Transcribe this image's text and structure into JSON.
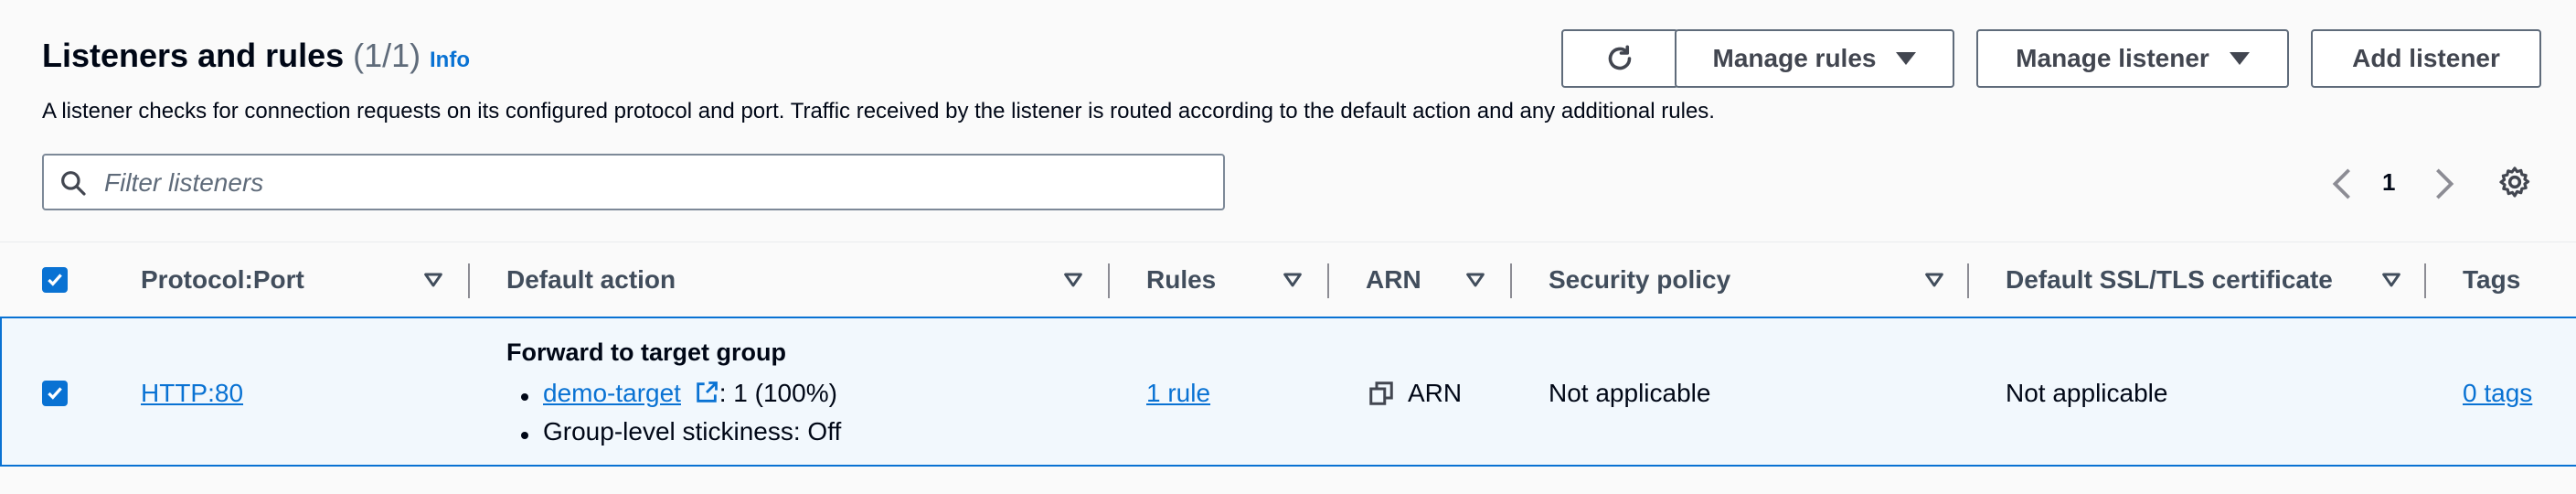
{
  "header": {
    "title": "Listeners and rules",
    "count": "(1/1)",
    "info_label": "Info",
    "description": "A listener checks for connection requests on its configured protocol and port. Traffic received by the listener is routed according to the default action and any additional rules."
  },
  "toolbar": {
    "refresh_icon": "refresh-icon",
    "manage_rules_label": "Manage rules",
    "manage_listener_label": "Manage listener",
    "add_listener_label": "Add listener"
  },
  "search": {
    "placeholder": "Filter listeners",
    "value": ""
  },
  "pagination": {
    "current_page": "1"
  },
  "columns": [
    {
      "label": "Protocol:Port"
    },
    {
      "label": "Default action"
    },
    {
      "label": "Rules"
    },
    {
      "label": "ARN"
    },
    {
      "label": "Security policy"
    },
    {
      "label": "Default SSL/TLS certificate"
    },
    {
      "label": "Tags"
    }
  ],
  "rows": [
    {
      "selected": true,
      "protocol_port": "HTTP:80",
      "default_action": {
        "title": "Forward to target group",
        "target_name": "demo-target",
        "target_weight": ": 1 (100%)",
        "stickiness": "Group-level stickiness: Off"
      },
      "rules": "1 rule",
      "arn": "ARN",
      "security_policy": "Not applicable",
      "ssl_certificate": "Not applicable",
      "tags": "0 tags"
    }
  ],
  "colors": {
    "accent": "#0972d3",
    "selected_row_bg": "#f2f8fd",
    "text": "#000716",
    "header_text": "#414d5c"
  }
}
